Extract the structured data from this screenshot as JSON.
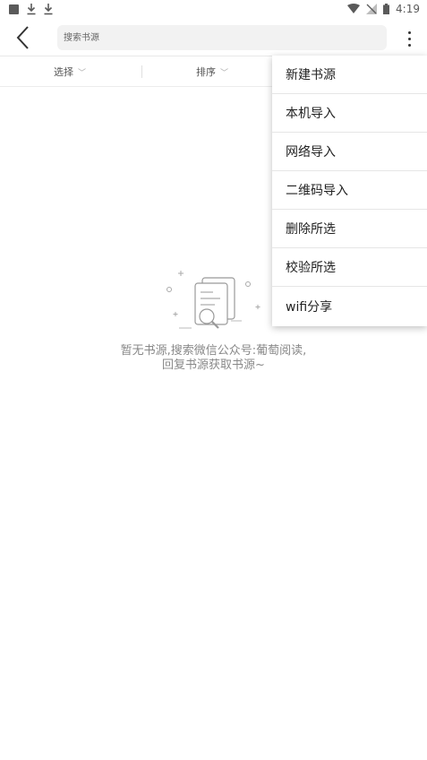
{
  "status_bar": {
    "time": "4:19"
  },
  "toolbar": {
    "search_placeholder": "搜索书源"
  },
  "filter_bar": {
    "select_label": "选择",
    "sort_label": "排序"
  },
  "empty_state": {
    "line1": "暂无书源,搜索微信公众号:葡萄阅读,",
    "line2": "回复书源获取书源~"
  },
  "menu": {
    "items": [
      {
        "label": "新建书源"
      },
      {
        "label": "本机导入"
      },
      {
        "label": "网络导入"
      },
      {
        "label": "二维码导入"
      },
      {
        "label": "删除所选"
      },
      {
        "label": "校验所选"
      },
      {
        "label": "wifi分享"
      }
    ]
  },
  "colors": {
    "status_icon": "#5a5a5a",
    "search_bg": "#f2f2f2",
    "text_muted": "#888888"
  }
}
